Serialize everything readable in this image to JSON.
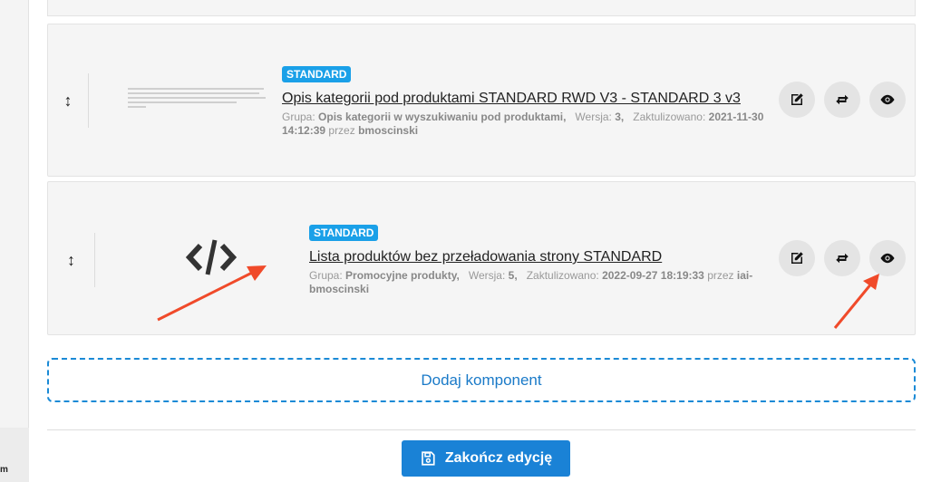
{
  "sidebar": {
    "partial_text": "m"
  },
  "components": [
    {
      "badge": "STANDARD",
      "title": "Opis kategorii pod produktami STANDARD RWD V3 - STANDARD 3 v3",
      "group_label": "Grupa:",
      "group_value": "Opis kategorii w wyszukiwaniu pod produktami,",
      "version_label": "Wersja:",
      "version_value": "3,",
      "updated_label": "Zaktulizowano:",
      "updated_value": "2021-11-30 14:12:39",
      "by_label": "przez",
      "by_value": "bmoscinski"
    },
    {
      "badge": "STANDARD",
      "title": "Lista produktów bez przeładowania strony STANDARD",
      "group_label": "Grupa:",
      "group_value": "Promocyjne produkty,",
      "version_label": "Wersja:",
      "version_value": "5,",
      "updated_label": "Zaktulizowano:",
      "updated_value": "2022-09-27 18:19:33",
      "by_label": "przez",
      "by_value": "iai-bmoscinski"
    }
  ],
  "add_component_label": "Dodaj komponent",
  "finish_edit_label": "Zakończ edycję",
  "colors": {
    "accent": "#1a82d6",
    "badge": "#1aa0e8",
    "arrow": "#f04a2a"
  },
  "icons": [
    "drag-handle-icon",
    "code-icon",
    "edit-icon",
    "repeat-icon",
    "eye-icon",
    "save-icon"
  ]
}
